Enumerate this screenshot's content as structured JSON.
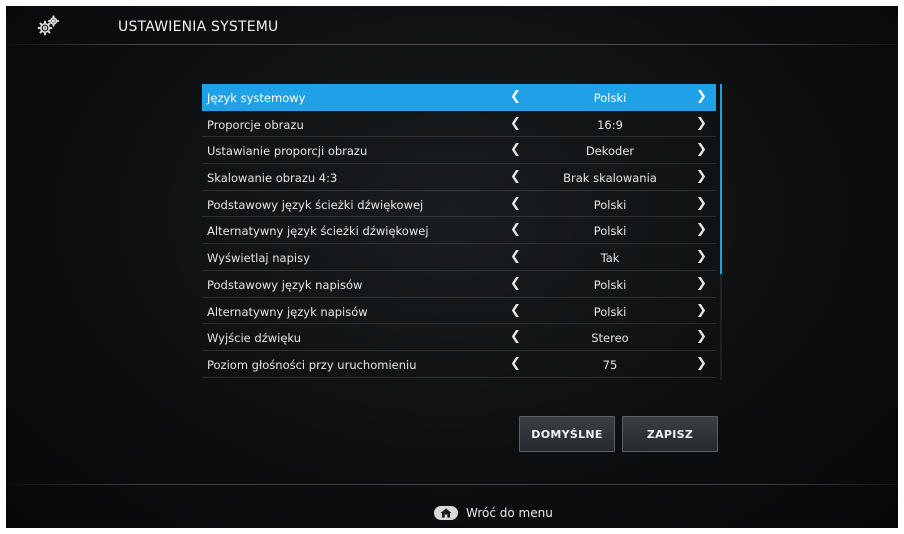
{
  "header": {
    "title": "USTAWIENIA SYSTEMU",
    "icon": "gears-icon"
  },
  "settings": [
    {
      "label": "Język systemowy",
      "value": "Polski",
      "selected": true
    },
    {
      "label": "Proporcje obrazu",
      "value": "16:9"
    },
    {
      "label": "Ustawianie proporcji obrazu",
      "value": "Dekoder"
    },
    {
      "label": "Skalowanie obrazu 4:3",
      "value": "Brak skalowania"
    },
    {
      "label": "Podstawowy język ścieżki dźwiękowej",
      "value": "Polski"
    },
    {
      "label": "Alternatywny język ścieżki dźwiękowej",
      "value": "Polski"
    },
    {
      "label": "Wyświetlaj napisy",
      "value": "Tak"
    },
    {
      "label": "Podstawowy język napisów",
      "value": "Polski"
    },
    {
      "label": "Alternatywny język napisów",
      "value": "Polski"
    },
    {
      "label": "Wyjście dźwięku",
      "value": "Stereo"
    },
    {
      "label": "Poziom głośności przy uruchomieniu",
      "value": "75"
    }
  ],
  "arrows": {
    "left": "❮",
    "right": "❯"
  },
  "buttons": {
    "default_label": "DOMYŚLNE",
    "save_label": "ZAPISZ"
  },
  "footer": {
    "back_label": "Wróć do menu",
    "icon": "home-key-icon"
  },
  "colors": {
    "accent": "#1fa1e8",
    "background": "#0d0f10"
  }
}
